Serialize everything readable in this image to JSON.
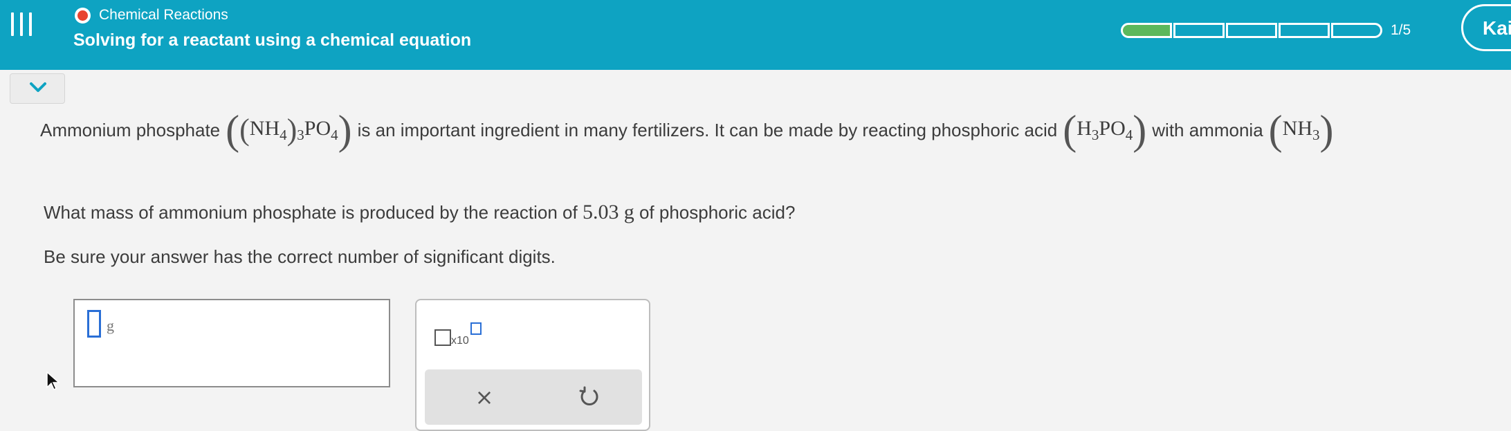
{
  "header": {
    "topic": "Chemical Reactions",
    "title": "Solving for a reactant using a chemical equation",
    "progress": {
      "completed": 1,
      "total": 5,
      "label": "1/5"
    },
    "profile_label": "Kai"
  },
  "problem": {
    "intro": {
      "t1": "Ammonium phosphate",
      "t2": "is an important ingredient in many fertilizers. It can be made by reacting phosphoric acid",
      "t3": "with ammonia"
    },
    "formulas": {
      "ammonium_phosphate": {
        "nh": "NH",
        "nh_sub": "4",
        "group_sub": "3",
        "po": "PO",
        "po_sub": "4"
      },
      "phosphoric_acid": {
        "h": "H",
        "h_sub": "3",
        "po": "PO",
        "po_sub": "4"
      },
      "ammonia": {
        "nh": "NH",
        "nh_sub": "3"
      }
    },
    "question": {
      "before": "What mass of ammonium phosphate is produced by the reaction of",
      "value": "5.03",
      "unit": "g",
      "after": "of phosphoric acid?"
    },
    "instruction": "Be sure your answer has the correct number of significant digits."
  },
  "answer": {
    "value": "",
    "unit": "g"
  },
  "tools": {
    "sci_notation_label": "x10",
    "clear_symbol": "×"
  },
  "icons": {
    "menu": "hamburger-menu-icon",
    "collapse": "chevron-down-icon",
    "topic": "topic-status-ring-icon",
    "reset": "undo-reset-icon",
    "cursor": "mouse-pointer-icon"
  },
  "colors": {
    "header": "#0ea3c2",
    "progress_fill": "#5cb85c",
    "topic_dot": "#e8442f",
    "input_focus": "#2a6fd6"
  }
}
